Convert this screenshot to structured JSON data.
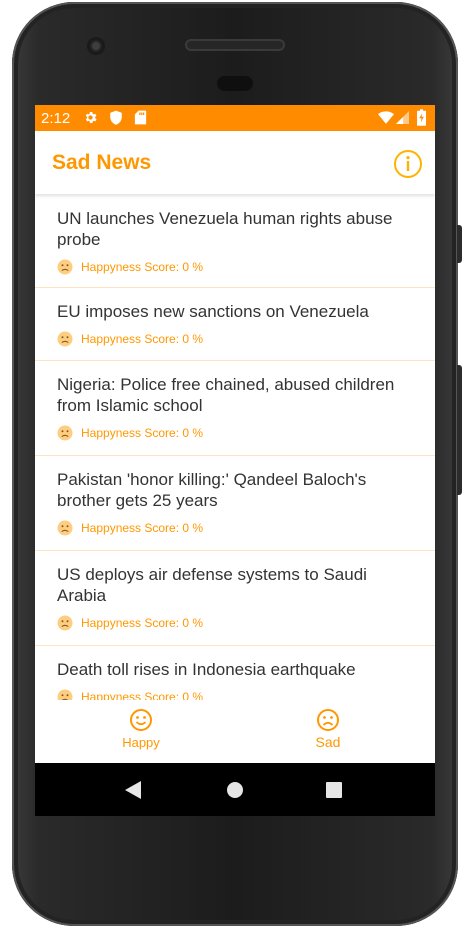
{
  "status_bar": {
    "time": "2:12",
    "left_icons": [
      "gear-icon",
      "shield-icon",
      "sd-card-icon"
    ],
    "right_icons": [
      "wifi-icon",
      "signal-icon",
      "battery-icon"
    ],
    "color": "#ff8c00"
  },
  "app_bar": {
    "title": "Sad News",
    "info_icon": "info-icon",
    "accent": "#ff9800"
  },
  "news": {
    "score_label": "Happyness Score: 0 %",
    "items": [
      {
        "title": "UN launches Venezuela human rights abuse probe",
        "score": "Happyness Score: 0 %"
      },
      {
        "title": "EU imposes new sanctions on Venezuela",
        "score": "Happyness Score: 0 %"
      },
      {
        "title": "Nigeria: Police free chained, abused children from Islamic school",
        "score": "Happyness Score: 0 %"
      },
      {
        "title": "Pakistan 'honor killing:' Qandeel Baloch's brother gets 25 years",
        "score": "Happyness Score: 0 %"
      },
      {
        "title": "US deploys air defense systems to Saudi Arabia",
        "score": "Happyness Score: 0 %"
      },
      {
        "title": "Death toll rises in Indonesia earthquake",
        "score": "Happyness Score: 0 %"
      }
    ]
  },
  "bottom_nav": {
    "tabs": [
      {
        "label": "Happy",
        "icon": "smile-face-icon"
      },
      {
        "label": "Sad",
        "icon": "sad-face-icon"
      }
    ],
    "selected": "Sad"
  },
  "system_nav": {
    "buttons": [
      "back-icon",
      "home-icon",
      "recents-icon"
    ]
  }
}
